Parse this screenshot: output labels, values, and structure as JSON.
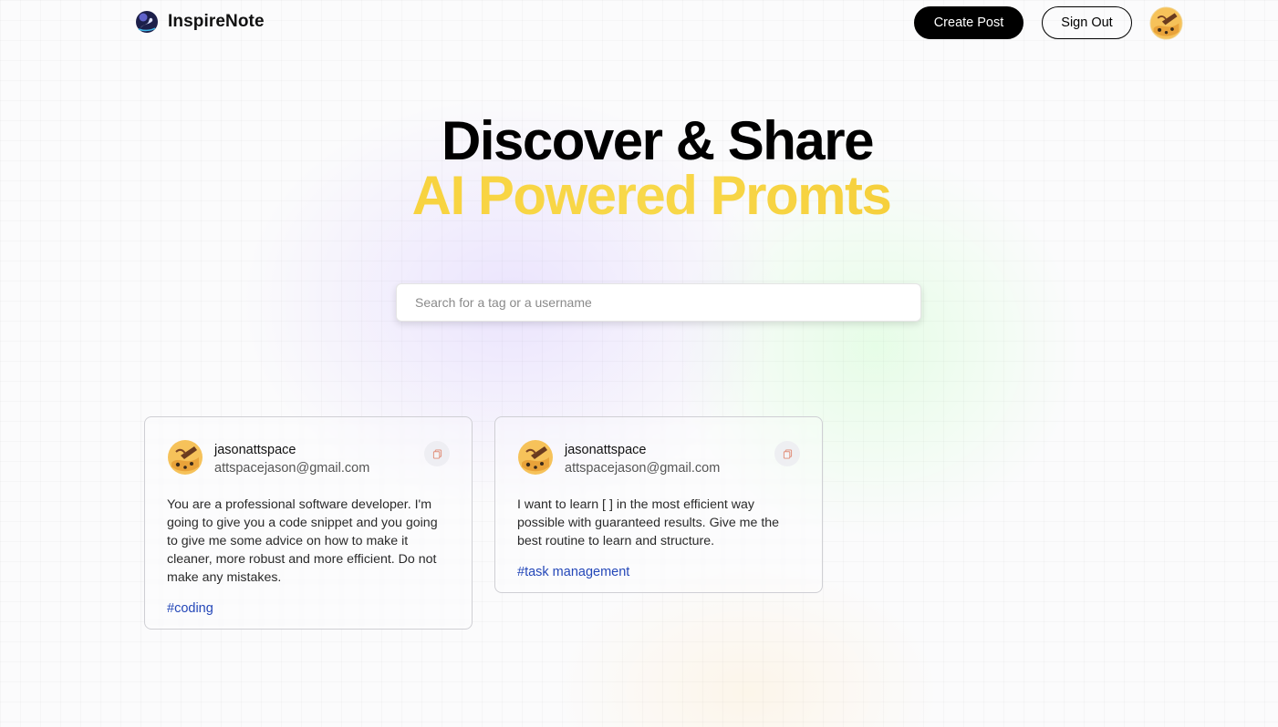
{
  "app": {
    "name": "InspireNote"
  },
  "nav": {
    "create_post_label": "Create Post",
    "sign_out_label": "Sign Out",
    "avatar_icon": "profile-avatar"
  },
  "hero": {
    "line1": "Discover & Share",
    "line2": "AI Powered Promts",
    "accent_color": "#f6c92c"
  },
  "search": {
    "placeholder": "Search for a tag or a username",
    "value": ""
  },
  "posts": [
    {
      "username": "jasonattspace",
      "email": "attspacejason@gmail.com",
      "prompt": "You are a professional software developer. I'm going to give you a code snippet and you going to give me some advice on how to make it cleaner, more robust and more efficient. Do not make any mistakes.",
      "tag": "#coding",
      "copy_icon": "copy-icon"
    },
    {
      "username": "jasonattspace",
      "email": "attspacejason@gmail.com",
      "prompt": "I want to learn [ ] in the most efficient way possible with guaranteed results. Give me the best routine to learn and structure.",
      "tag": "#task management",
      "copy_icon": "copy-icon"
    }
  ],
  "colors": {
    "tag_link": "#2447b8",
    "primary_button": "#000000"
  }
}
